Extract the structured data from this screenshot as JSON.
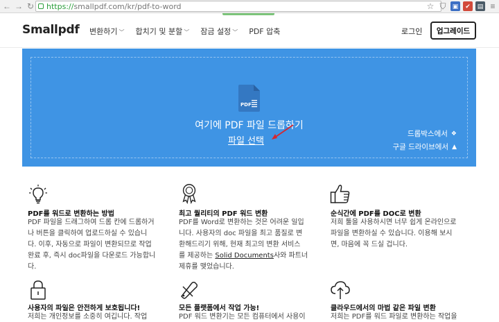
{
  "browser": {
    "url_scheme": "https://",
    "url_rest": "smallpdf.com/kr/pdf-to-word"
  },
  "header": {
    "logo": "Smallpdf",
    "nav": [
      "변환하기",
      "합치기 및 분할",
      "잠금 설정",
      "PDF 압축"
    ],
    "login": "로그인",
    "upgrade": "업그레이드"
  },
  "dropzone": {
    "pdf_label": "PDF",
    "title": "여기에 PDF 파일 드롭하기",
    "choose": "파일 선택",
    "dropbox": "드롭박스에서",
    "gdrive": "구글 드라이브에서"
  },
  "features": [
    {
      "title": "PDF를 워드로 변환하는 방법",
      "lines": [
        "PDF 파일을 드래그하여 드롭 칸에 드롭하거",
        "나 버튼을 클릭하여 업로드하실 수 있습니",
        "다. 이후, 자동으로 파일이 변환되므로 작업",
        "완료 후, 즉시 doc파일을 다운로드 가능합니",
        "다."
      ]
    },
    {
      "title": "최고 퀄리티의 PDF 워드 변환",
      "lines": [
        "PDF를 Word로 변환하는 것은 어려운 일입",
        "니다. 사용자의 doc 파일을 최고 품질로 변",
        "환해드리기 위해, 현재 최고의 변환 서비스"
      ],
      "line4_pre": "를 제공하는 ",
      "line4_link": "Solid Documents",
      "line4_post": "사와 파트너",
      "line5": "제휴를 맺었습니다."
    },
    {
      "title": "순식간에 PDF를 DOC로 변환",
      "lines": [
        "저희 툴을 사용하시면 너무 쉽게 온라인으로",
        "파일을 변환하실 수 있습니다. 이용해 보시",
        "면, 마음에 꼭 드실 겁니다."
      ]
    },
    {
      "title": "사용자의 파일은 안전하게 보호됩니다!",
      "lines": [
        "저희는 개인정보를 소중히 여깁니다. 작업"
      ]
    },
    {
      "title": "모든 플랫폼에서 작업 가능!",
      "lines": [
        "PDF 워드 변환기는 모든 컴퓨터에서 사용이"
      ]
    },
    {
      "title": "클라우드에서의 마법 같은 파일 변환",
      "lines": [
        "저희는 PDF를 워드 파일로 변환하는 작업을"
      ]
    }
  ]
}
